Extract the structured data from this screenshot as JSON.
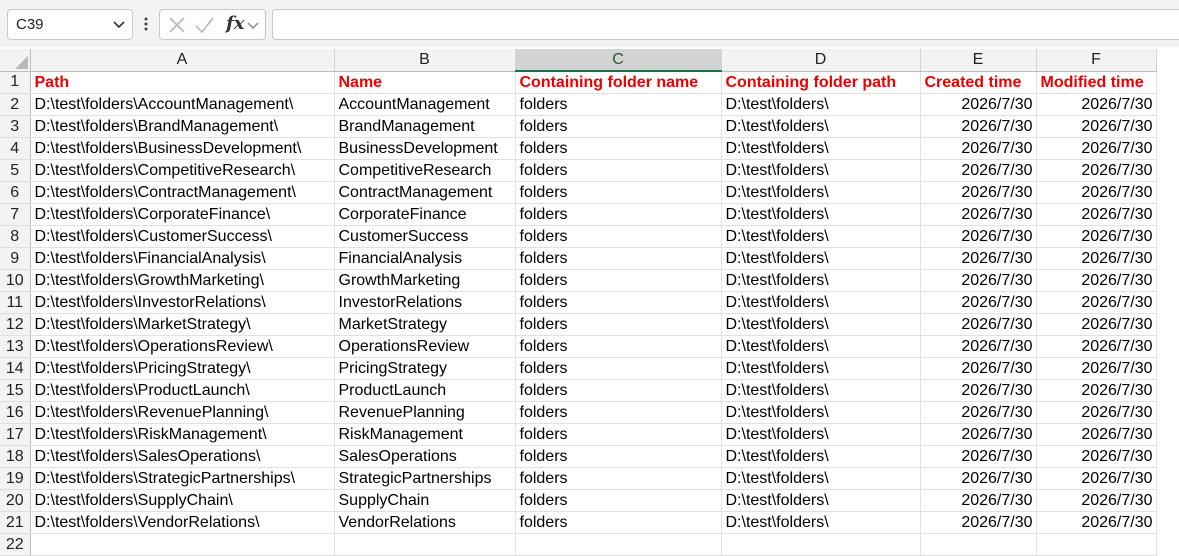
{
  "formula_bar": {
    "name_box": "C39",
    "fx_label": "fx",
    "formula": ""
  },
  "columns": [
    "A",
    "B",
    "C",
    "D",
    "E",
    "F"
  ],
  "selected_column": "C",
  "header_row": {
    "row": "1",
    "cells": [
      "Path",
      "Name",
      "Containing folder name",
      "Containing folder path",
      "Created time",
      "Modified time"
    ]
  },
  "rows": [
    {
      "row": "2",
      "cells": [
        "D:\\test\\folders\\AccountManagement\\",
        "AccountManagement",
        "folders",
        "D:\\test\\folders\\",
        "2026/7/30",
        "2026/7/30"
      ]
    },
    {
      "row": "3",
      "cells": [
        "D:\\test\\folders\\BrandManagement\\",
        "BrandManagement",
        "folders",
        "D:\\test\\folders\\",
        "2026/7/30",
        "2026/7/30"
      ]
    },
    {
      "row": "4",
      "cells": [
        "D:\\test\\folders\\BusinessDevelopment\\",
        "BusinessDevelopment",
        "folders",
        "D:\\test\\folders\\",
        "2026/7/30",
        "2026/7/30"
      ]
    },
    {
      "row": "5",
      "cells": [
        "D:\\test\\folders\\CompetitiveResearch\\",
        "CompetitiveResearch",
        "folders",
        "D:\\test\\folders\\",
        "2026/7/30",
        "2026/7/30"
      ]
    },
    {
      "row": "6",
      "cells": [
        "D:\\test\\folders\\ContractManagement\\",
        "ContractManagement",
        "folders",
        "D:\\test\\folders\\",
        "2026/7/30",
        "2026/7/30"
      ]
    },
    {
      "row": "7",
      "cells": [
        "D:\\test\\folders\\CorporateFinance\\",
        "CorporateFinance",
        "folders",
        "D:\\test\\folders\\",
        "2026/7/30",
        "2026/7/30"
      ]
    },
    {
      "row": "8",
      "cells": [
        "D:\\test\\folders\\CustomerSuccess\\",
        "CustomerSuccess",
        "folders",
        "D:\\test\\folders\\",
        "2026/7/30",
        "2026/7/30"
      ]
    },
    {
      "row": "9",
      "cells": [
        "D:\\test\\folders\\FinancialAnalysis\\",
        "FinancialAnalysis",
        "folders",
        "D:\\test\\folders\\",
        "2026/7/30",
        "2026/7/30"
      ]
    },
    {
      "row": "10",
      "cells": [
        "D:\\test\\folders\\GrowthMarketing\\",
        "GrowthMarketing",
        "folders",
        "D:\\test\\folders\\",
        "2026/7/30",
        "2026/7/30"
      ]
    },
    {
      "row": "11",
      "cells": [
        "D:\\test\\folders\\InvestorRelations\\",
        "InvestorRelations",
        "folders",
        "D:\\test\\folders\\",
        "2026/7/30",
        "2026/7/30"
      ]
    },
    {
      "row": "12",
      "cells": [
        "D:\\test\\folders\\MarketStrategy\\",
        "MarketStrategy",
        "folders",
        "D:\\test\\folders\\",
        "2026/7/30",
        "2026/7/30"
      ]
    },
    {
      "row": "13",
      "cells": [
        "D:\\test\\folders\\OperationsReview\\",
        "OperationsReview",
        "folders",
        "D:\\test\\folders\\",
        "2026/7/30",
        "2026/7/30"
      ]
    },
    {
      "row": "14",
      "cells": [
        "D:\\test\\folders\\PricingStrategy\\",
        "PricingStrategy",
        "folders",
        "D:\\test\\folders\\",
        "2026/7/30",
        "2026/7/30"
      ]
    },
    {
      "row": "15",
      "cells": [
        "D:\\test\\folders\\ProductLaunch\\",
        "ProductLaunch",
        "folders",
        "D:\\test\\folders\\",
        "2026/7/30",
        "2026/7/30"
      ]
    },
    {
      "row": "16",
      "cells": [
        "D:\\test\\folders\\RevenuePlanning\\",
        "RevenuePlanning",
        "folders",
        "D:\\test\\folders\\",
        "2026/7/30",
        "2026/7/30"
      ]
    },
    {
      "row": "17",
      "cells": [
        "D:\\test\\folders\\RiskManagement\\",
        "RiskManagement",
        "folders",
        "D:\\test\\folders\\",
        "2026/7/30",
        "2026/7/30"
      ]
    },
    {
      "row": "18",
      "cells": [
        "D:\\test\\folders\\SalesOperations\\",
        "SalesOperations",
        "folders",
        "D:\\test\\folders\\",
        "2026/7/30",
        "2026/7/30"
      ]
    },
    {
      "row": "19",
      "cells": [
        "D:\\test\\folders\\StrategicPartnerships\\",
        "StrategicPartnerships",
        "folders",
        "D:\\test\\folders\\",
        "2026/7/30",
        "2026/7/30"
      ]
    },
    {
      "row": "20",
      "cells": [
        "D:\\test\\folders\\SupplyChain\\",
        "SupplyChain",
        "folders",
        "D:\\test\\folders\\",
        "2026/7/30",
        "2026/7/30"
      ]
    },
    {
      "row": "21",
      "cells": [
        "D:\\test\\folders\\VendorRelations\\",
        "VendorRelations",
        "folders",
        "D:\\test\\folders\\",
        "2026/7/30",
        "2026/7/30"
      ]
    },
    {
      "row": "22",
      "cells": [
        "",
        "",
        "",
        "",
        "",
        ""
      ]
    }
  ],
  "colors": {
    "header_text": "#ee0000",
    "selected_column_accent": "#1e7145"
  },
  "icons": [
    "chevron-down-icon",
    "more-options-icon",
    "cancel-icon",
    "enter-icon",
    "function-icon"
  ]
}
